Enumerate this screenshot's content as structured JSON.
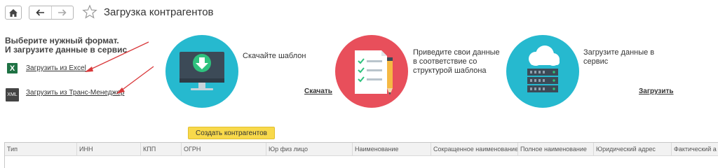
{
  "header": {
    "home_icon": "home-icon",
    "back_icon": "arrow-left-icon",
    "forward_icon": "arrow-right-icon",
    "favorite_icon": "star-icon",
    "title": "Загрузка контрагентов"
  },
  "sidebar": {
    "intro_line1": "Выберите нужный формат.",
    "intro_line2": "И загрузите данные в сервис",
    "excel_icon_text": "X",
    "excel_link": "Загрузить из Excel",
    "xml_icon_text": "XML",
    "xml_link": "Загрузить из Транс-Менеджер"
  },
  "steps": [
    {
      "icon": "monitor-download-icon",
      "text_lines": [
        "Скачайте шаблон"
      ],
      "link": "Скачать"
    },
    {
      "icon": "checklist-pencil-icon",
      "text_lines": [
        "Приведите свои данные",
        "в соответствие со",
        "структурой шаблона"
      ]
    },
    {
      "icon": "cloud-server-icon",
      "text_lines": [
        "Загрузите данные в",
        "сервис"
      ],
      "link": "Загрузить"
    }
  ],
  "actions": {
    "create_button": "Создать контрагентов"
  },
  "table": {
    "columns": [
      "Тип",
      "ИНН",
      "КПП",
      "ОГРН",
      "Юр физ лицо",
      "Наименование",
      "Сокращенное наименование",
      "Полное наименование",
      "Юридический адрес",
      "Фактический а"
    ],
    "rows": []
  },
  "colors": {
    "teal": "#26b9cf",
    "red": "#e84f5b",
    "button_yellow": "#f8d94b",
    "excel_green": "#1f7244",
    "annotation_arrow": "#d9393b"
  }
}
